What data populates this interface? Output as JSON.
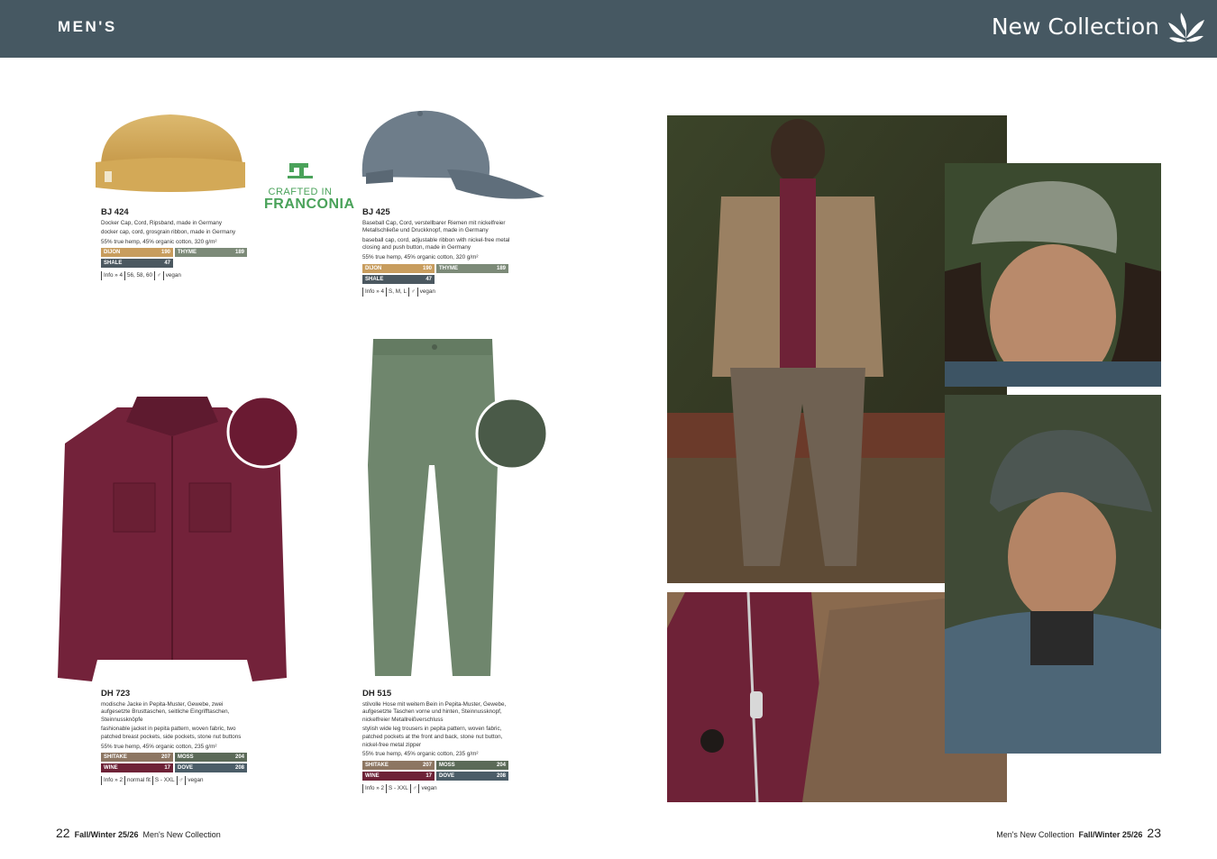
{
  "header": {
    "section": "MEN'S",
    "collection": "New Collection"
  },
  "badge": {
    "line1": "CRAFTED IN",
    "line2": "FRANCONIA"
  },
  "products": {
    "bj424": {
      "code": "BJ 424",
      "desc_de": "Docker Cap, Cord, Ripsband, made in Germany",
      "desc_en": "docker cap, cord, grosgrain ribbon, made in Germany",
      "material": "55% true hemp, 45% organic cotton, 320 g/m²",
      "colors": [
        {
          "name": "DIJON",
          "num": "190",
          "hex": "#c89d5e"
        },
        {
          "name": "THYME",
          "num": "189",
          "hex": "#7c8a78"
        },
        {
          "name": "SHALE",
          "num": "47",
          "hex": "#4b5860"
        }
      ],
      "info": [
        "Info » 4",
        "56, 58, 60",
        "♂",
        "vegan"
      ]
    },
    "bj425": {
      "code": "BJ 425",
      "desc_de": "Baseball Cap, Cord, verstellbarer Riemen mit nickelfreier Metallschließe und Druckknopf, made in Germany",
      "desc_en": "baseball cap, cord, adjustable ribbon with nickel-free metal closing and push button, made in Germany",
      "material": "55% true hemp, 45% organic cotton, 320 g/m²",
      "colors": [
        {
          "name": "DIJON",
          "num": "190",
          "hex": "#c89d5e"
        },
        {
          "name": "THYME",
          "num": "189",
          "hex": "#7c8a78"
        },
        {
          "name": "SHALE",
          "num": "47",
          "hex": "#4b5860"
        }
      ],
      "info": [
        "Info » 4",
        "S, M, L",
        "♂",
        "vegan"
      ]
    },
    "dh723": {
      "code": "DH 723",
      "desc_de": "modische Jacke in Pepita-Muster, Gewebe, zwei aufgesetzte Brusttaschen, seitliche Eingrifftaschen, Steinnussknöpfe",
      "desc_en": "fashionable jacket in pepita pattern, woven fabric, two patched breast pockets, side pockets, stone nut buttons",
      "material": "55% true hemp, 45% organic cotton, 235 g/m²",
      "colors": [
        {
          "name": "SHITAKE",
          "num": "207",
          "hex": "#8d7662"
        },
        {
          "name": "MOSS",
          "num": "204",
          "hex": "#5b6a58"
        },
        {
          "name": "WINE",
          "num": "17",
          "hex": "#6e2237"
        },
        {
          "name": "DOVE",
          "num": "208",
          "hex": "#4b5d68"
        }
      ],
      "info": [
        "Info » 2",
        "normal fit",
        "S - XXL",
        "♂",
        "vegan"
      ]
    },
    "dh515": {
      "code": "DH 515",
      "desc_de": "stilvolle Hose mit weitem Bein in Pepita-Muster, Gewebe, aufgesetzte Taschen vorne und hinten, Steinnussknopf, nickelfreier Metallreißverschluss",
      "desc_en": "stylish wide leg trousers in pepita pattern, woven fabric, patched pockets at the front and back, stone nut button, nickel-free metal zipper",
      "material": "55% true hemp, 45% organic cotton, 235 g/m²",
      "colors": [
        {
          "name": "SHITAKE",
          "num": "207",
          "hex": "#8d7662"
        },
        {
          "name": "MOSS",
          "num": "204",
          "hex": "#5b6a58"
        },
        {
          "name": "WINE",
          "num": "17",
          "hex": "#6e2237"
        },
        {
          "name": "DOVE",
          "num": "208",
          "hex": "#4b5d68"
        }
      ],
      "info": [
        "Info » 2",
        "S - XXL",
        "♂",
        "vegan"
      ]
    }
  },
  "footer": {
    "left_page": "22",
    "right_page": "23",
    "season": "Fall/Winter 25/26",
    "label": "Men's New Collection"
  }
}
